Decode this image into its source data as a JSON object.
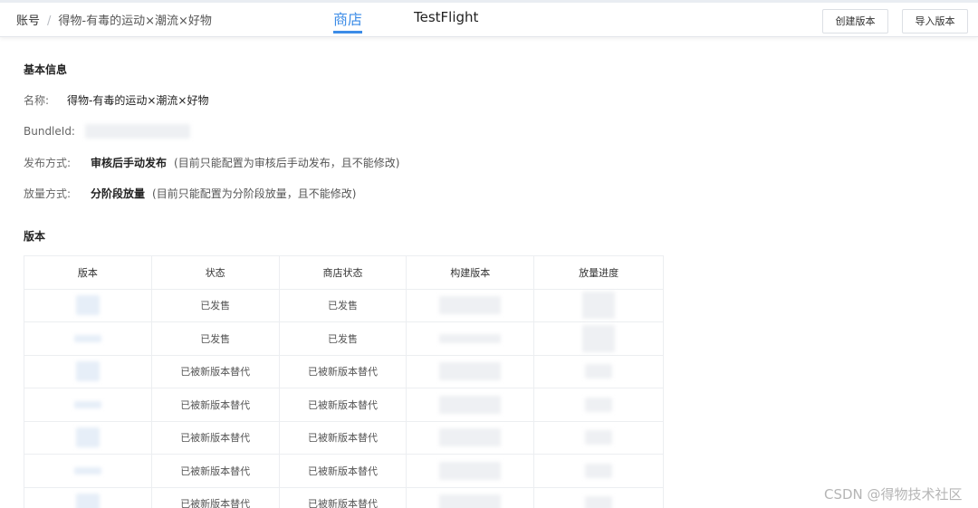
{
  "header": {
    "breadcrumb_root": "账号",
    "breadcrumb_sep": "/",
    "breadcrumb_app": "得物-有毒的运动×潮流×好物",
    "tab_store": "商店",
    "tab_testflight": "TestFlight",
    "create_version_label": "创建版本",
    "import_version_label": "导入版本"
  },
  "basic_info": {
    "title": "基本信息",
    "name_label": "名称:",
    "name_value": "得物-有毒的运动×潮流×好物",
    "bundle_label": "BundleId:",
    "release_label": "发布方式:",
    "release_value": "审核后手动发布",
    "release_note": "(目前只能配置为审核后手动发布，且不能修改)",
    "rollout_label": "放量方式:",
    "rollout_value": "分阶段放量",
    "rollout_note": "(目前只能配置为分阶段放量，且不能修改)"
  },
  "versions": {
    "title": "版本",
    "columns": [
      "版本",
      "状态",
      "商店状态",
      "构建版本",
      "放量进度"
    ],
    "rows": [
      {
        "status": "已发售",
        "store_status": "已发售"
      },
      {
        "status": "已发售",
        "store_status": "已发售"
      },
      {
        "status": "已被新版本替代",
        "store_status": "已被新版本替代"
      },
      {
        "status": "已被新版本替代",
        "store_status": "已被新版本替代"
      },
      {
        "status": "已被新版本替代",
        "store_status": "已被新版本替代"
      },
      {
        "status": "已被新版本替代",
        "store_status": "已被新版本替代"
      },
      {
        "status": "已被新版本替代",
        "store_status": "已被新版本替代"
      }
    ]
  },
  "watermark": "CSDN @得物技术社区"
}
